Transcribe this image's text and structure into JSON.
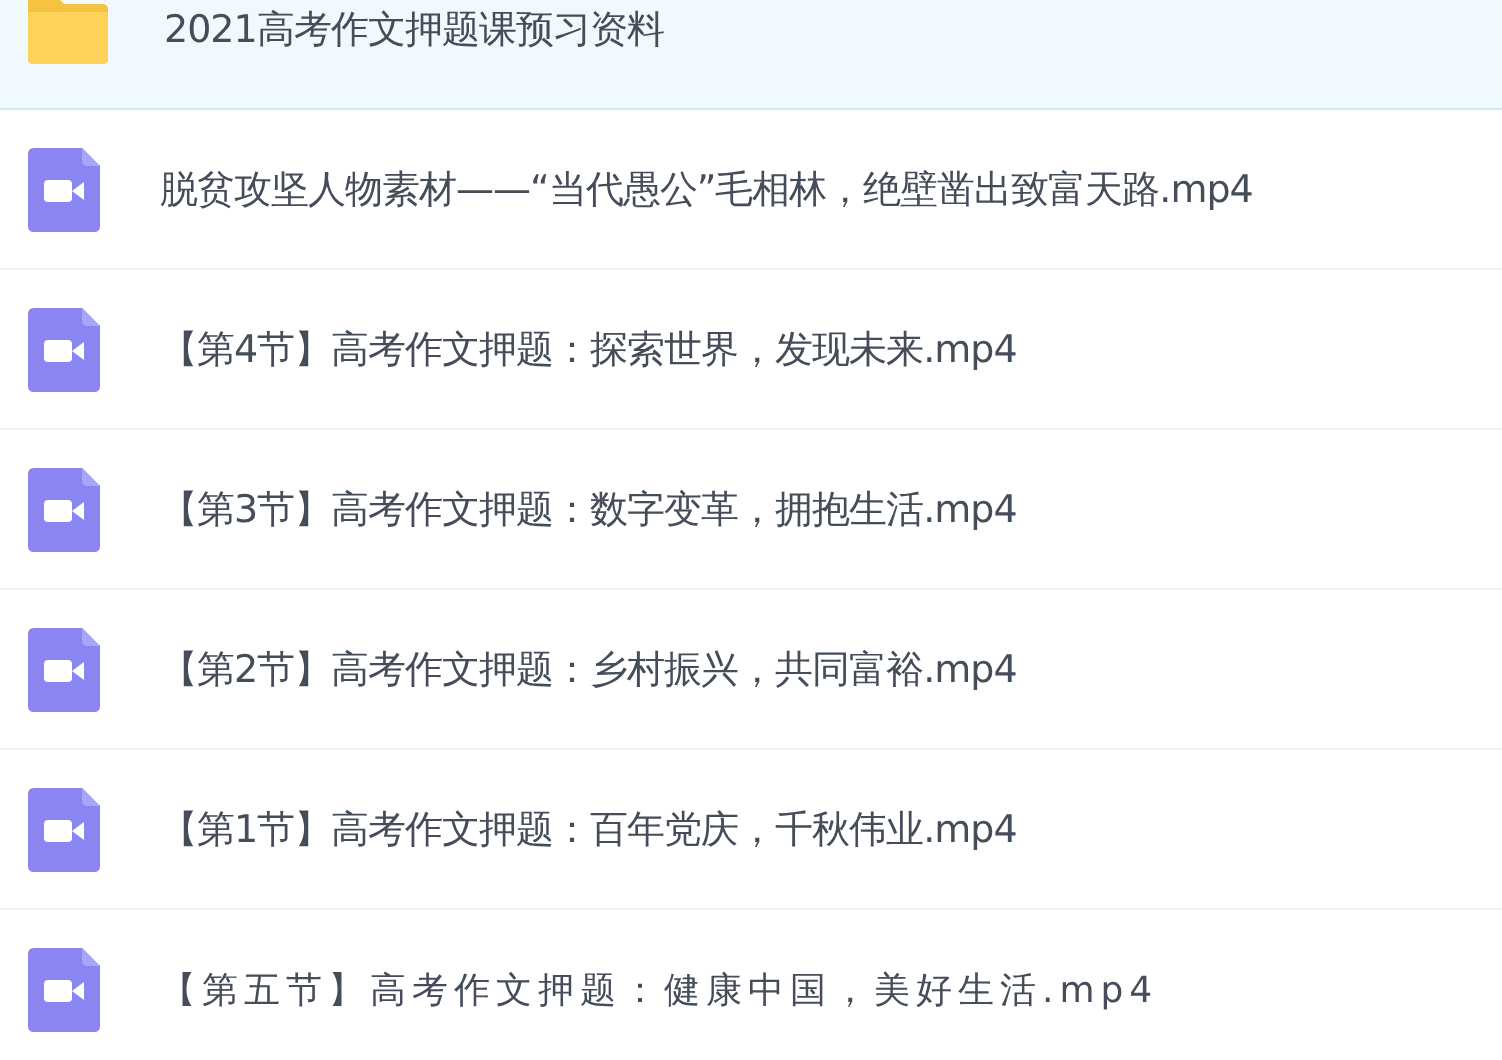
{
  "files": [
    {
      "kind": "folder",
      "name": "2021高考作文押题课预习资料",
      "selected": true,
      "spaced": false
    },
    {
      "kind": "video",
      "name": "脱贫攻坚人物素材——“当代愚公”毛相林，绝壁凿出致富天路.mp4",
      "selected": false,
      "spaced": false
    },
    {
      "kind": "video",
      "name": "【第4节】高考作文押题：探索世界，发现未来.mp4",
      "selected": false,
      "spaced": false
    },
    {
      "kind": "video",
      "name": "【第3节】高考作文押题：数字变革，拥抱生活.mp4",
      "selected": false,
      "spaced": false
    },
    {
      "kind": "video",
      "name": "【第2节】高考作文押题：乡村振兴，共同富裕.mp4",
      "selected": false,
      "spaced": false
    },
    {
      "kind": "video",
      "name": "【第1节】高考作文押题：百年党庆，千秋伟业.mp4",
      "selected": false,
      "spaced": false
    },
    {
      "kind": "video",
      "name": "【第五节】高考作文押题：健康中国，美好生活.mp4",
      "selected": false,
      "spaced": true
    }
  ]
}
